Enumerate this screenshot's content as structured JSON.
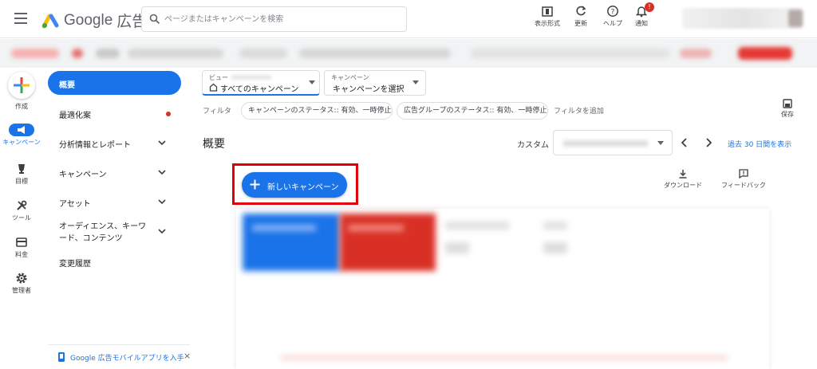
{
  "header": {
    "product": "広告",
    "brand_word": "Google",
    "search_placeholder": "ページまたはキャンペーンを検索",
    "buttons": {
      "appearance": "表示形式",
      "refresh": "更新",
      "help": "ヘルプ",
      "notifications": "通知"
    },
    "notification_count": "!"
  },
  "rail": {
    "create": "作成",
    "campaigns": "キャンペーン",
    "goals": "目標",
    "tools": "ツール",
    "billing": "料金",
    "admin": "管理者"
  },
  "sidebar": {
    "items": [
      {
        "label": "概要"
      },
      {
        "label": "最適化案"
      },
      {
        "label": "分析情報とレポート"
      },
      {
        "label": "キャンペーン"
      },
      {
        "label": "アセット"
      },
      {
        "label": "オーディエンス、キーワード、コンテンツ"
      },
      {
        "label": "変更履歴"
      }
    ],
    "mobile_app": "Google 広告モバイルアプリを入手"
  },
  "main": {
    "view_caption": "ビュー",
    "view_value": "すべてのキャンペーン",
    "campaign_caption": "キャンペーン",
    "campaign_value": "キャンペーンを選択",
    "filter_label": "フィルタ",
    "filter_chips": [
      "キャンペーンのステータス:: 有効、一時停止",
      "広告グループのステータス:: 有効、一時停止"
    ],
    "add_filter": "フィルタを追加",
    "save": "保存",
    "page_title": "概要",
    "date_range_label": "カスタム",
    "date_shortcut": "過去 30 日間を表示",
    "new_campaign": "新しいキャンペーン",
    "download": "ダウンロード",
    "feedback": "フィードバック"
  },
  "colors": {
    "accent": "#1a73e8",
    "alert": "#d93025",
    "highlight_outline": "#e0000a"
  }
}
